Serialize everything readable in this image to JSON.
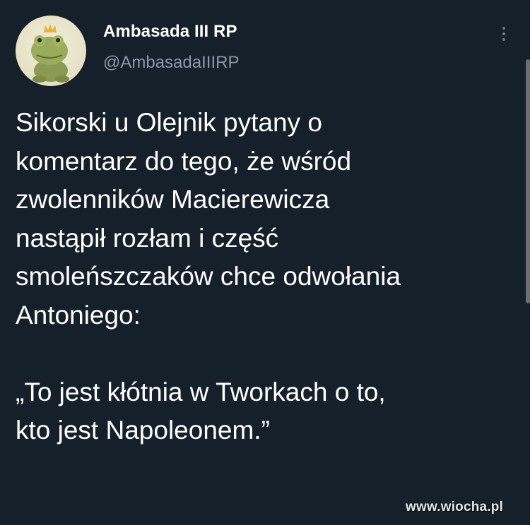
{
  "tweet": {
    "display_name": "Ambasada III RP",
    "handle": "@AmbasadaIIIRP",
    "body": "Sikorski u Olejnik pytany o\nkomentarz do tego, że wśród\nzwolenników Macierewicza\nnastąpił rozłam i część\nsmoleńszczaków chce odwołania\nAntoniego:\n\n„To jest kłótnia w Tworkach o to,\nkto jest Napoleonem.”",
    "avatar_icon": "frog-with-crown-icon",
    "more_icon": "more-vertical-icon"
  },
  "watermark": {
    "text": "www.wiocha.pl"
  },
  "colors": {
    "background": "#15202b",
    "text_primary": "#ffffff",
    "text_secondary": "#8b98a5"
  }
}
